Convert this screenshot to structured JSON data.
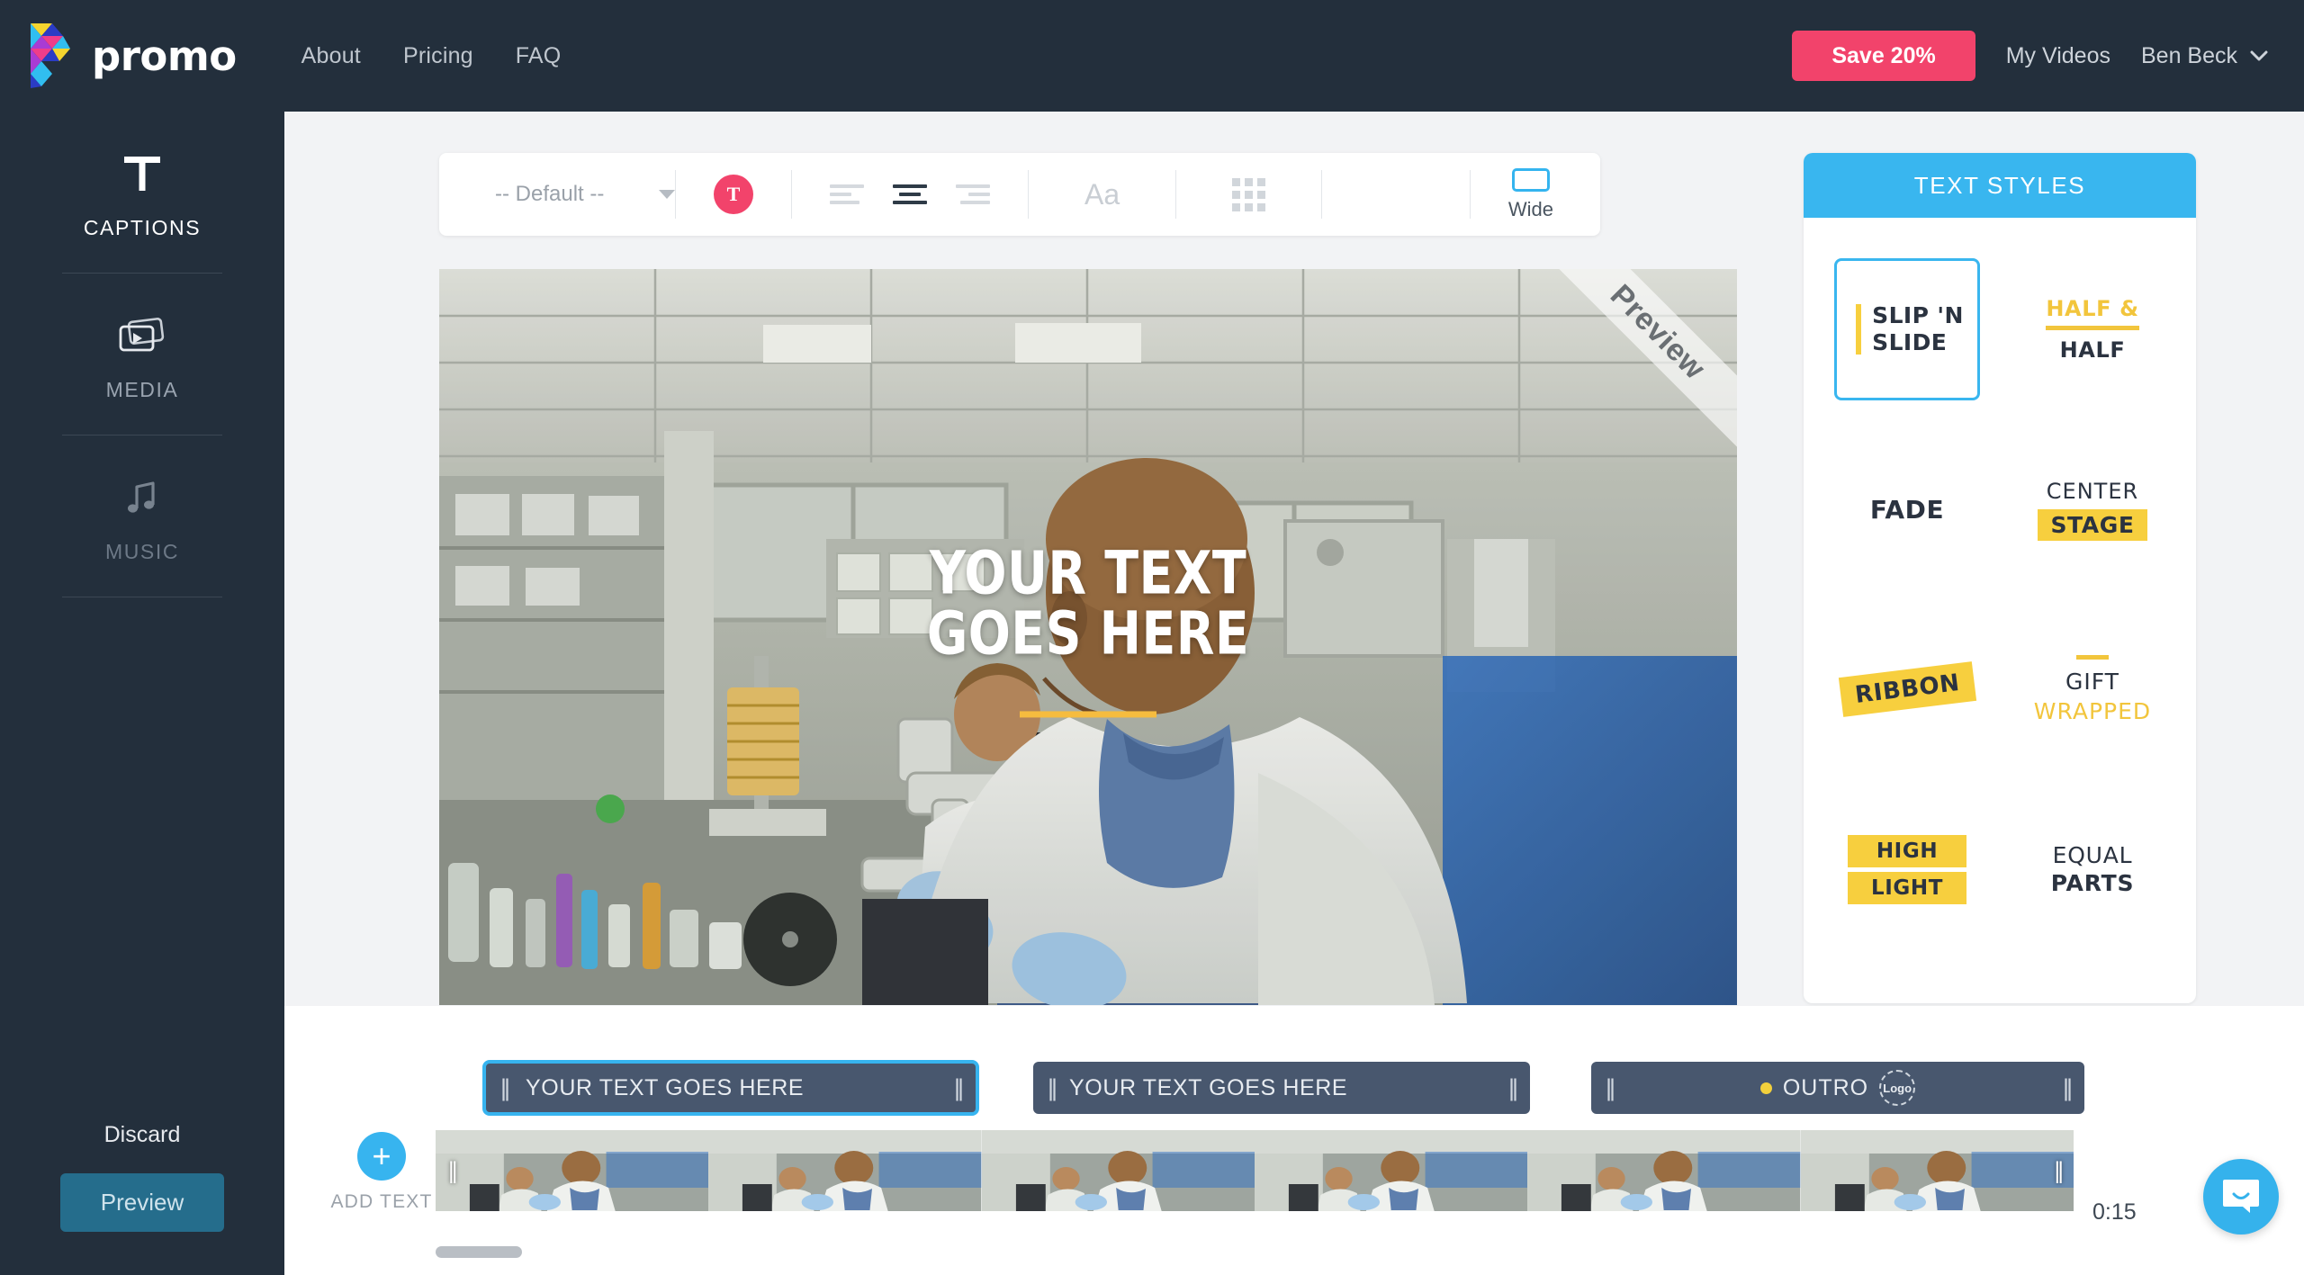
{
  "header": {
    "brand_name": "promo",
    "logo_icon": "promo-triangles-logo",
    "nav": [
      {
        "label": "About"
      },
      {
        "label": "Pricing"
      },
      {
        "label": "FAQ"
      }
    ],
    "save_button": "Save 20%",
    "my_videos": "My Videos",
    "user_name": "Ben Beck",
    "chevron_icon": "chevron-down-icon",
    "accent_pink": "#f2436b",
    "bar_color": "#232f3c"
  },
  "sidebar": {
    "items": [
      {
        "label": "CAPTIONS",
        "icon": "text-t-icon",
        "state": "active"
      },
      {
        "label": "MEDIA",
        "icon": "media-clips-icon",
        "state": "dim"
      },
      {
        "label": "MUSIC",
        "icon": "music-note-icon",
        "state": "dimmer"
      }
    ],
    "discard": "Discard",
    "preview": "Preview"
  },
  "toolbar": {
    "font_select_value": "-- Default --",
    "caret_icon": "chevron-down-icon",
    "color_swatch": {
      "icon": "text-color-icon",
      "glyph": "T",
      "color": "#f2436b"
    },
    "align": [
      {
        "name": "align-left",
        "active": false
      },
      {
        "name": "align-center",
        "active": true
      },
      {
        "name": "align-right",
        "active": false
      }
    ],
    "font_size_label": "Aa",
    "grid_icon": "grid-layout-icon",
    "aspect": {
      "label": "Wide",
      "icon": "aspect-wide-icon",
      "color": "#34b4ef"
    }
  },
  "video": {
    "watermark": "Preview",
    "caption_line1": "YOUR TEXT",
    "caption_line2": "GOES HERE",
    "underline_color": "#f6bc3f",
    "scene_description": "laboratory scientists at microscopes"
  },
  "text_styles": {
    "title": "TEXT STYLES",
    "header_color": "#39b6ef",
    "items": [
      {
        "name": "slip-n-slide",
        "line1": "SLIP 'N",
        "line2": "SLIDE",
        "selected": true
      },
      {
        "name": "half-and-half",
        "line1": "HALF &",
        "line2": "HALF",
        "selected": false
      },
      {
        "name": "fade",
        "line1": "FADE",
        "line2": "",
        "selected": false
      },
      {
        "name": "center-stage",
        "line1": "CENTER",
        "line2": "STAGE",
        "selected": false
      },
      {
        "name": "ribbon",
        "line1": "RIBBON",
        "line2": "",
        "selected": false
      },
      {
        "name": "gift-wrapped",
        "line1": "GIFT",
        "line2": "WRAPPED",
        "selected": false
      },
      {
        "name": "highlight",
        "line1": "HIGH",
        "line2": "LIGHT",
        "selected": false
      },
      {
        "name": "equal-parts",
        "line1": "EQUAL",
        "line2": "PARTS",
        "selected": false
      }
    ],
    "yellow": "#f7cf3e"
  },
  "timeline": {
    "add_text_label": "ADD TEXT",
    "add_icon": "plus-icon",
    "segments": [
      {
        "name": "caption-segment-1",
        "text": "YOUR TEXT GOES HERE",
        "selected": true,
        "type": "caption"
      },
      {
        "name": "caption-segment-2",
        "text": "YOUR TEXT GOES HERE",
        "selected": false,
        "type": "caption"
      },
      {
        "name": "outro-segment",
        "text": "OUTRO",
        "logo_label": "Logo",
        "selected": false,
        "type": "outro",
        "dot_color": "#f2d03c"
      }
    ],
    "duration": "0:15",
    "handle_glyph": "||"
  },
  "chat": {
    "icon": "chat-bubble-icon",
    "color": "#35b2ec"
  }
}
